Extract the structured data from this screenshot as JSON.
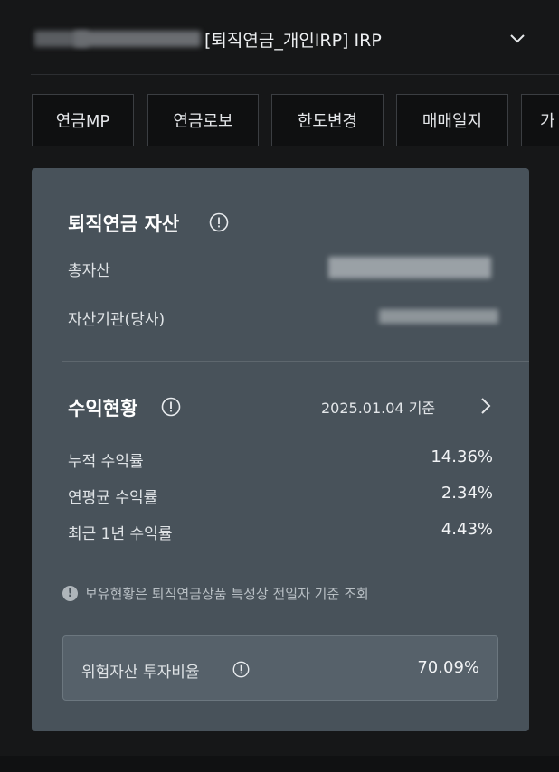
{
  "header": {
    "account_title": "[퇴직연금_개인IRP] IRP"
  },
  "tabs": [
    {
      "label": "연금MP"
    },
    {
      "label": "연금로보"
    },
    {
      "label": "한도변경"
    },
    {
      "label": "매매일지"
    },
    {
      "label": "가"
    }
  ],
  "assets": {
    "title": "퇴직연금 자산",
    "total_label": "총자산",
    "institution_label": "자산기관(당사)"
  },
  "returns": {
    "title": "수익현황",
    "date": "2025.01.04 기준",
    "rows": [
      {
        "label": "누적 수익률",
        "value": "14.36%"
      },
      {
        "label": "연평균 수익률",
        "value": "2.34%"
      },
      {
        "label": "최근 1년 수익률",
        "value": "4.43%"
      }
    ],
    "notice": "보유현황은 퇴직연금상품 특성상 전일자 기준 조회"
  },
  "risk": {
    "label": "위험자산 투자비율",
    "value": "70.09%"
  },
  "colors": {
    "background": "#161718",
    "card": "#48525a",
    "risk_box": "#56616a"
  }
}
